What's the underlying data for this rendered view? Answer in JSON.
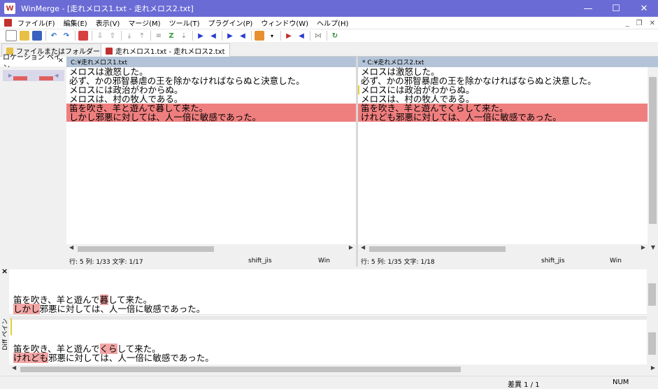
{
  "window": {
    "title": "WinMerge - [走れメロス1.txt - 走れメロス2.txt]",
    "minimize": "—",
    "maximize": "☐",
    "close": "✕"
  },
  "menu": [
    "ファイル(F)",
    "編集(E)",
    "表示(V)",
    "マージ(M)",
    "ツール(T)",
    "プラグイン(P)",
    "ウィンドウ(W)",
    "ヘルプ(H)"
  ],
  "mdi": {
    "min": "_",
    "restore": "❐",
    "close": "✕"
  },
  "tabs": [
    {
      "label": "ファイルまたはフォルダーの選択..."
    },
    {
      "label": "走れメロス1.txt - 走れメロス2.txt"
    }
  ],
  "location_pane": {
    "title": "ロケーション ペイン",
    "close": "×"
  },
  "left": {
    "header": "C:¥走れメロス1.txt",
    "lines": [
      "メロスは激怒した。",
      "必ず、かの邪智暴虐の王を除かなければならぬと決意した。",
      "メロスには政治がわからぬ。",
      "メロスは、村の牧人である。",
      "笛を吹き、羊と遊んで暮して来た。",
      "しかし邪悪に対しては、人一倍に敏感であった。"
    ],
    "status": {
      "position": "行: 5  列: 1/33  文字: 1/17",
      "encoding": "shift_jis",
      "eol": "Win"
    }
  },
  "right": {
    "header": "* C:¥走れメロス2.txt",
    "lines": [
      "メロスは激怒した。",
      "必ず、かの邪智暴虐の王を除かなければならぬと決意した。",
      "メロスには政治がわからぬ。",
      "メロスは、村の牧人である。",
      "笛を吹き、羊と遊んでくらして来た。",
      "けれども邪悪に対しては、人一倍に敏感であった。"
    ],
    "status": {
      "position": "行: 5  列: 1/35  文字: 1/18",
      "encoding": "shift_jis",
      "eol": "Win"
    }
  },
  "diff_pane": {
    "label": "Diff ペイン",
    "close": "×",
    "top": [
      {
        "pre": "笛を吹き、羊と遊んで",
        "hl": "暮",
        "post": "して来た。"
      },
      {
        "pre": "",
        "hl": "しかし",
        "post": "邪悪に対しては、人一倍に敏感であった。"
      }
    ],
    "bottom": [
      {
        "pre": "笛を吹き、羊と遊んで",
        "hl": "くら",
        "post": "して来た。"
      },
      {
        "pre": "",
        "hl": "けれども",
        "post": "邪悪に対しては、人一倍に敏感であった。"
      }
    ]
  },
  "statusbar": {
    "diff": "差異 1 / 1",
    "num": "NUM"
  },
  "colors": {
    "titlebar": "#6b6bd6",
    "diff_line": "#ef7f7f",
    "file_header": "#b4c4d8",
    "diff_word": "#f3a6a6"
  }
}
